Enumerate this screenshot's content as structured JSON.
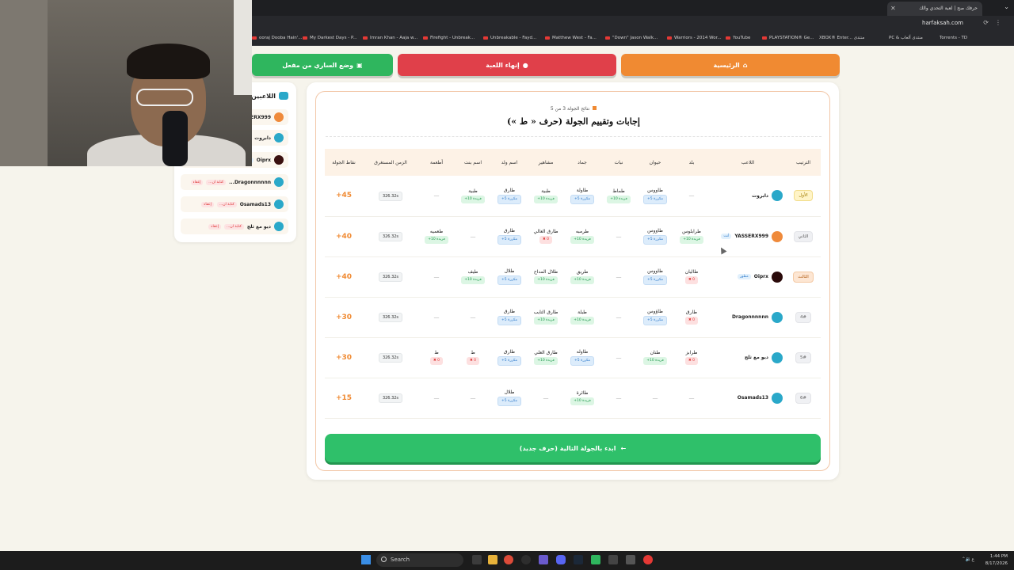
{
  "browser": {
    "tab_title": "حرفك صح | لعبة التحدي والك",
    "url": "harfaksah.com",
    "bookmarks": [
      "ooraj Dooba Hain'...",
      "My Darkest Days - P...",
      "Imran Khan - Aaja w...",
      "Firefight - Unbreak...",
      "Unbreakable - Fayd...",
      "Matthew West - Fa...",
      "\"Down\" Jason Walk...",
      "Warriors - 2014 Wor...",
      "YouTube",
      "PLAYSTATION® Ge...",
      "XBOX® Enter... منتدى",
      "PC & منتدى ألعاب",
      "Torrents - TD"
    ]
  },
  "nav": {
    "home": "الرئيسية",
    "end_game": "إنهاء اللعبة",
    "mode": "وضع الساري من مفعل"
  },
  "players_panel": {
    "title": "اللاعبين",
    "players": [
      {
        "name": "YASSERX999",
        "avatar": "orange"
      },
      {
        "name": "دابروت",
        "avatar": "teal"
      },
      {
        "name": "Oiprx",
        "avatar": "dark",
        "tag": "مطور"
      },
      {
        "name": "Dragonnnnnn...",
        "avatar": "teal",
        "tag1": "كتابة ان...",
        "tag2": "إعفاء"
      },
      {
        "name": "Osamads13",
        "avatar": "teal",
        "tag1": "كتابة ان...",
        "tag2": "إعفاء"
      },
      {
        "name": "ديو مع ثلج",
        "avatar": "teal",
        "tag1": "كتابة ان...",
        "tag2": "إعفاء"
      }
    ]
  },
  "results": {
    "round_info": "نتائج الجولة 3 من 5",
    "title": "إجابات وتقييم الجولة (حرف « ط »)",
    "headers": [
      "الترتيب",
      "اللاعب",
      "بلد",
      "حيوان",
      "نبات",
      "جماد",
      "مشاهير",
      "اسم ولد",
      "اسم بنت",
      "أطعمة",
      "الزمن المستغرق",
      "نقاط الجولة"
    ],
    "rows": [
      {
        "rank": "الأول",
        "rank_style": "gold",
        "player": "دابروت",
        "avatar": "teal",
        "badge": "",
        "sub": "",
        "cells": [
          null,
          {
            "word": "طاووس",
            "status": "dup",
            "chip": "مكررة 5+"
          },
          {
            "word": "طماط",
            "status": "unique",
            "chip": "فريدة 10+"
          },
          {
            "word": "طاولة",
            "status": "dup",
            "chip": "مكررة 5+"
          },
          {
            "word": "طبية",
            "status": "unique",
            "chip": "فريدة 10+"
          },
          {
            "word": "طارق",
            "status": "dup",
            "chip": "مكررة 5+"
          },
          {
            "word": "طبية",
            "status": "unique",
            "chip": "فريدة 10+"
          },
          null
        ],
        "time": "326.32s",
        "points": "45+"
      },
      {
        "rank": "الثاني",
        "rank_style": "silver",
        "player": "YASSERX999",
        "avatar": "orange",
        "badge": "",
        "sub": "أنت",
        "cells": [
          {
            "word": "طرابلوس",
            "status": "unique",
            "chip": "فريدة 10+"
          },
          {
            "word": "طاووس",
            "status": "dup",
            "chip": "مكررة 5+"
          },
          null,
          {
            "word": "طرمبه",
            "status": "unique",
            "chip": "فريدة 10+"
          },
          {
            "word": "طارق العالي",
            "status": "wrong",
            "chip": "0 ✖"
          },
          {
            "word": "طارق",
            "status": "dup",
            "chip": "مكررة 5+"
          },
          null,
          {
            "word": "طعميه",
            "status": "unique",
            "chip": "فريدة 10+"
          }
        ],
        "time": "326.32s",
        "points": "40+"
      },
      {
        "rank": "الثالث",
        "rank_style": "bronze",
        "player": "Oiprx",
        "avatar": "dark",
        "badge": "مطور",
        "sub": "",
        "cells": [
          {
            "word": "طاليان",
            "status": "wrong",
            "chip": "0 ✖"
          },
          {
            "word": "طاووس",
            "status": "dup",
            "chip": "مكررة 5+"
          },
          null,
          {
            "word": "طريق",
            "status": "unique",
            "chip": "فريدة 10+"
          },
          {
            "word": "طلال المداح",
            "status": "unique",
            "chip": "فريدة 10+"
          },
          {
            "word": "طلال",
            "status": "dup",
            "chip": "مكررة 5+"
          },
          {
            "word": "طيف",
            "status": "unique",
            "chip": "فريدة 10+"
          },
          null
        ],
        "time": "326.32s",
        "points": "40+"
      },
      {
        "rank": "4#",
        "rank_style": "plain",
        "player": "Dragonnnnnn",
        "avatar": "teal",
        "badge": "",
        "sub": "",
        "cells": [
          {
            "word": "طارق",
            "status": "wrong",
            "chip": "0 ✖"
          },
          {
            "word": "طاؤوس",
            "status": "dup",
            "chip": "مكررة 5+"
          },
          null,
          {
            "word": "طبلة",
            "status": "unique",
            "chip": "فريدة 10+"
          },
          {
            "word": "طارق التايب",
            "status": "unique",
            "chip": "فريدة 10+"
          },
          {
            "word": "طارق",
            "status": "dup",
            "chip": "مكررة 5+"
          },
          null,
          null
        ],
        "time": "326.32s",
        "points": "30+"
      },
      {
        "rank": "5#",
        "rank_style": "plain",
        "player": "ديو مع ثلج",
        "avatar": "teal",
        "badge": "",
        "sub": "",
        "cells": [
          {
            "word": "طرابز",
            "status": "wrong",
            "chip": "0 ✖"
          },
          {
            "word": "طنان",
            "status": "unique",
            "chip": "فريدة 10+"
          },
          null,
          {
            "word": "طاوله",
            "status": "dup",
            "chip": "مكررة 5+"
          },
          {
            "word": "طارق العلي",
            "status": "unique",
            "chip": "فريدة 10+"
          },
          {
            "word": "طارق",
            "status": "dup",
            "chip": "مكررة 5+"
          },
          {
            "word": "ط",
            "status": "wrong",
            "chip": "0 ✖"
          },
          {
            "word": "ط",
            "status": "wrong",
            "chip": "0 ✖"
          }
        ],
        "time": "326.32s",
        "points": "30+"
      },
      {
        "rank": "6#",
        "rank_style": "plain",
        "player": "Osamads13",
        "avatar": "teal",
        "badge": "",
        "sub": "",
        "cells": [
          null,
          null,
          null,
          {
            "word": "طائرة",
            "status": "unique",
            "chip": "فريدة 10+"
          },
          null,
          {
            "word": "طلال",
            "status": "dup",
            "chip": "مكررة 5+"
          },
          null,
          null
        ],
        "time": "326.32s",
        "points": "15+"
      }
    ],
    "next_button": "ابدء بالجولة التالية (حرف جديد)"
  },
  "taskbar": {
    "search_placeholder": "Search",
    "time": "1:44 PM",
    "date": "8/17/2026"
  },
  "colors": {
    "accent_orange": "#f08a32",
    "danger_red": "#e0404a",
    "success_green": "#2fc06a"
  }
}
